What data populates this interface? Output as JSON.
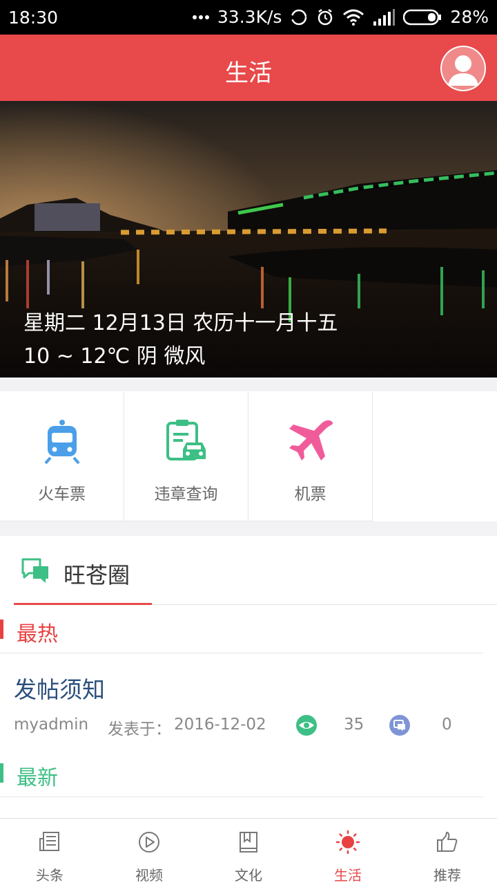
{
  "status_bar": {
    "time": "18:30",
    "network_speed": "33.3K/s",
    "battery": "28%"
  },
  "header": {
    "title": "生活"
  },
  "banner": {
    "date_line": "星期二 12月13日 农历十一月十五",
    "weather_line": "10 ~ 12℃ 阴 微风"
  },
  "services": [
    {
      "label": "火车票",
      "icon": "train-icon",
      "color": "#4a9fe8"
    },
    {
      "label": "违章查询",
      "icon": "traffic-violation-icon",
      "color": "#3dbf85"
    },
    {
      "label": "机票",
      "icon": "airplane-icon",
      "color": "#f05c9a"
    }
  ],
  "community": {
    "title": "旺苍圈",
    "hot_label": "最热",
    "new_label": "最新",
    "post": {
      "title": "发帖须知",
      "author": "myadmin",
      "date_label": "发表于：",
      "date": "2016-12-02",
      "views": "35",
      "comments": "0"
    }
  },
  "bottom_nav": [
    {
      "label": "头条",
      "icon": "newspaper-icon",
      "active": false
    },
    {
      "label": "视频",
      "icon": "play-icon",
      "active": false
    },
    {
      "label": "文化",
      "icon": "book-icon",
      "active": false
    },
    {
      "label": "生活",
      "icon": "sun-icon",
      "active": true
    },
    {
      "label": "推荐",
      "icon": "thumbs-up-icon",
      "active": false
    }
  ],
  "colors": {
    "accent": "#e8494a",
    "hot": "#e84141",
    "new": "#3dbf85",
    "post_title": "#2c4f7c"
  }
}
